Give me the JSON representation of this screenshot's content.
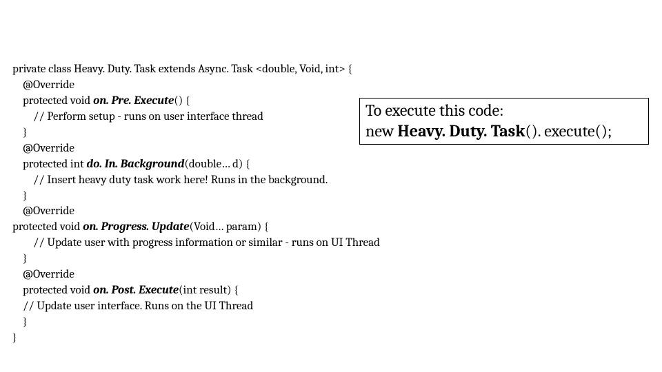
{
  "code": {
    "l1": "private class Heavy. Duty. Task extends Async. Task <double, Void, int> {",
    "l2": "    @Override",
    "l3_a": "    protected void ",
    "l3_b": "on. Pre. Execute",
    "l3_c": "() {",
    "l4": "        // Perform setup - runs on user interface thread",
    "l5": "    }",
    "blank1": "",
    "l6": "    @Override",
    "l7_a": "    protected int ",
    "l7_b": "do. In. Background",
    "l7_c": "(double… d) {",
    "l8": "        // Insert heavy duty task work here! Runs in the background.",
    "l9": "    }",
    "blank2": "",
    "l10": "    @Override",
    "l11_a": "protected void ",
    "l11_b": "on. Progress. Update",
    "l11_c": "(Void… param) {",
    "l12": "        // Update user with progress information or similar - runs on UI Thread",
    "l13": "    }",
    "blank3": "",
    "l14": "    @Override",
    "l15_a": "    protected void ",
    "l15_b": "on. Post. Execute",
    "l15_c": "(int result) {",
    "l16": "    // Update user interface. Runs on the UI Thread",
    "l17": "    }",
    "l18": "}"
  },
  "callout": {
    "line1": "To execute this code:",
    "line2_a": "new ",
    "line2_b": "Heavy. Duty. Task",
    "line2_c": "(). execute();"
  }
}
